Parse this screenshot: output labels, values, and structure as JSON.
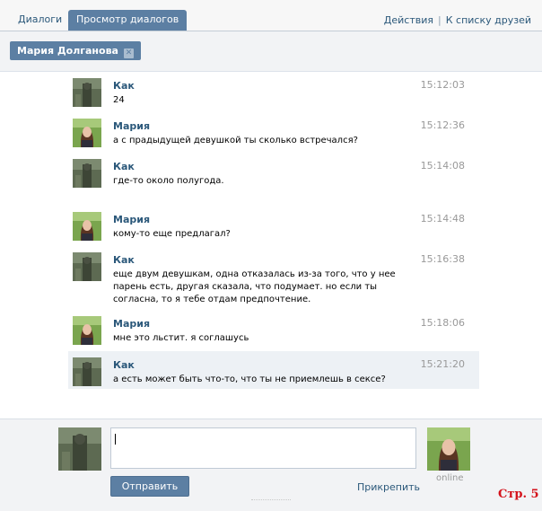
{
  "tabs": [
    {
      "label": "Диалоги"
    },
    {
      "label": "Просмотр диалогов"
    }
  ],
  "top_links": {
    "actions": "Действия",
    "separator": "|",
    "to_friends": "К списку друзей"
  },
  "recipient": {
    "name": "Мария Долганова",
    "remove_glyph": "✕"
  },
  "messages": [
    {
      "author": "Как",
      "text": "24",
      "time": "15:12:03"
    },
    {
      "author": "Мария",
      "text": "а с прадыдущей девушкой ты сколько встречался?",
      "time": "15:12:36"
    },
    {
      "author": "Как",
      "text": "где-то около полугода.",
      "time": "15:14:08"
    },
    {
      "author": "Мария",
      "text": "кому-то еще предлагал?",
      "time": "15:14:48"
    },
    {
      "author": "Как",
      "text": "еще двум девушкам, одна отказалась из-за того, что у нее парень есть, другая сказала, что подумает. но если ты согласна, то я тебе отдам предпочтение.",
      "time": "15:16:38"
    },
    {
      "author": "Мария",
      "text": "мне это льстит. я соглашусь",
      "time": "15:18:06"
    },
    {
      "author": "Как",
      "text": "а есть может быть что-то, что ты не приемлешь в сексе?",
      "time": "15:21:20"
    }
  ],
  "compose": {
    "value": "",
    "send_label": "Отправить",
    "attach_label": "Прикрепить",
    "status": "online"
  },
  "page_label": "Стр. 5",
  "colors": {
    "accent": "#5c7fa3",
    "link": "#2b587a",
    "highlight_row": "#edf1f5",
    "page_label": "#d4111a"
  }
}
